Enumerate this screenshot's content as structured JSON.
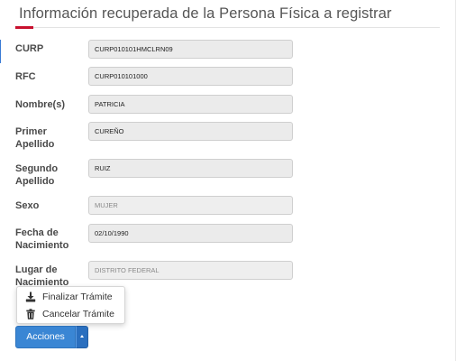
{
  "header": {
    "title": "Información recuperada de la Persona Física a registrar"
  },
  "fields": [
    {
      "label": "CURP",
      "value": "CURP010101HMCLRN09"
    },
    {
      "label": "RFC",
      "value": "CURP010101000"
    },
    {
      "label": "Nombre(s)",
      "value": "PATRICIA"
    },
    {
      "label_line1": "Primer",
      "label_line2": "Apellido",
      "value": "CUREÑO"
    },
    {
      "label_line1": "Segundo",
      "label_line2": "Apellido",
      "value": "RUIZ"
    },
    {
      "label": "Sexo",
      "placeholder": "MUJER"
    },
    {
      "label_line1": "Fecha de",
      "label_line2": "Nacimiento",
      "value": "02/10/1990"
    },
    {
      "label_line1": "Lugar de",
      "label_line2": "Nacimiento",
      "placeholder": "DISTRITO FEDERAL"
    }
  ],
  "actions_menu": {
    "items": [
      {
        "label": "Finalizar Trámite",
        "icon": "download-icon"
      },
      {
        "label": "Cancelar Trámite",
        "icon": "trash-icon"
      }
    ]
  },
  "actions_button": {
    "label": "Acciones",
    "caret_icon": "caret-up-icon"
  },
  "colors": {
    "accent_red": "#c8102e",
    "button_blue": "#3a86d4",
    "button_blue_dark": "#2a6fbf",
    "field_bg": "#ebebeb"
  }
}
